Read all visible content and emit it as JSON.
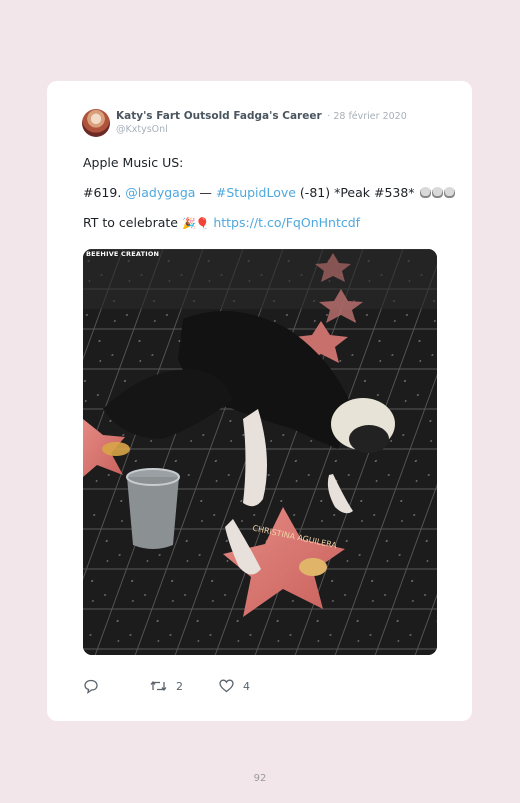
{
  "tweet": {
    "display_name": "Katy's Fart Outsold Fadga's Career",
    "date": "· 28 février 2020",
    "handle": "@KxtysOnl",
    "line1": "Apple Music US:",
    "line2": {
      "prefix": "#619. ",
      "mention": "@ladygaga",
      "dash": " — ",
      "hashtag": "#StupidLove",
      "suffix": " (-81) *Peak #538* "
    },
    "line3": {
      "text": "RT to celebrate ",
      "emojis": "🎉🎈",
      "link": "https://t.co/FqOnHntcdf"
    },
    "media": {
      "watermark": "BEEHIVE CREATION",
      "star_name": "CHRISTINA AGUILERA"
    },
    "actions": {
      "retweet_count": "2",
      "like_count": "4"
    }
  },
  "page": {
    "number": "92"
  },
  "colors": {
    "link": "#4ea8de",
    "background": "#f3e6ea",
    "card": "#ffffff"
  },
  "icons": [
    "reply-icon",
    "retweet-icon",
    "like-icon",
    "skull-icon"
  ]
}
